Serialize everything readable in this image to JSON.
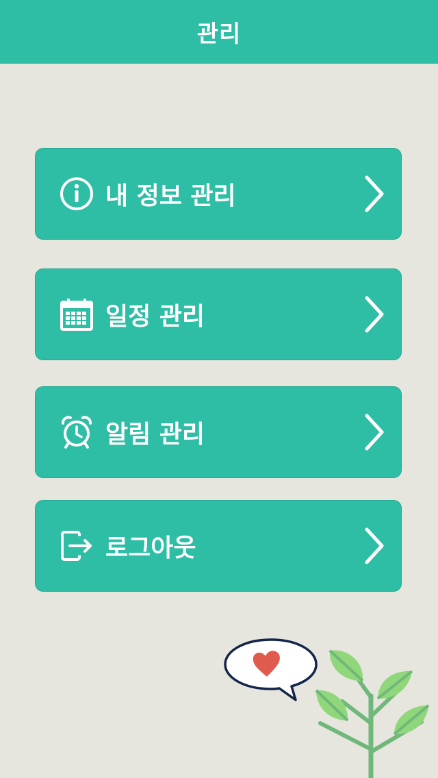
{
  "header": {
    "title": "관리"
  },
  "menu": [
    {
      "label": "내 정보 관리",
      "icon": "info-icon"
    },
    {
      "label": "일정 관리",
      "icon": "calendar-icon"
    },
    {
      "label": "알림 관리",
      "icon": "alarm-clock-icon"
    },
    {
      "label": "로그아웃",
      "icon": "logout-icon"
    }
  ],
  "colors": {
    "accent": "#2ebda5",
    "background": "#e6e5de",
    "heart": "#e05a4e",
    "leaf": "#8fd77a"
  }
}
